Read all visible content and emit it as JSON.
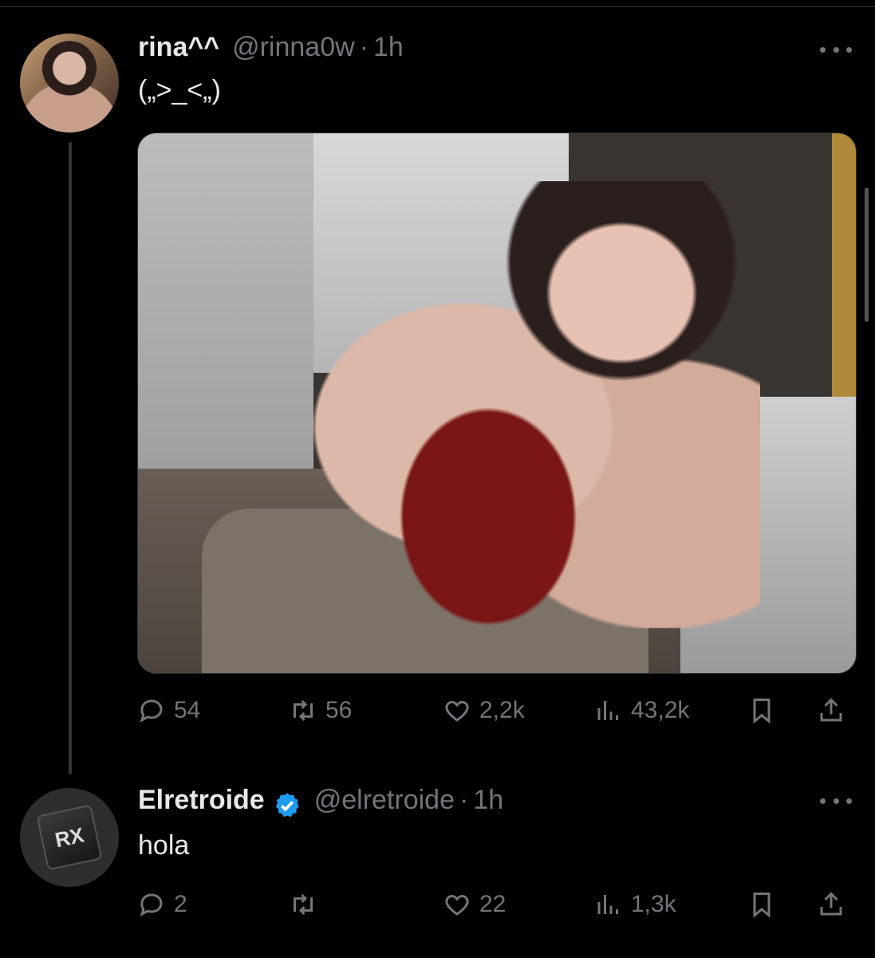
{
  "tweets": [
    {
      "name": "rina^^",
      "handle": "@rinna0w",
      "separator": "·",
      "time": "1h",
      "text": "(„>_<„)",
      "has_media": true,
      "actions": {
        "reply_count": "54",
        "retweet_count": "56",
        "like_count": "2,2k",
        "view_count": "43,2k"
      }
    },
    {
      "name": "Elretroide",
      "handle": "@elretroide",
      "separator": "·",
      "time": "1h",
      "text": "hola",
      "verified": true,
      "actions": {
        "reply_count": "2",
        "retweet_count": "",
        "like_count": "22",
        "view_count": "1,3k"
      }
    }
  ],
  "avatar_logo_text": "RX",
  "colors": {
    "background": "#000000",
    "text_primary": "#e7e9ea",
    "text_secondary": "#71767b",
    "verified_badge": "#1d9bf0",
    "divider": "#2f3336"
  },
  "icons": [
    "more-icon",
    "reply-icon",
    "retweet-icon",
    "like-icon",
    "views-icon",
    "bookmark-icon",
    "share-icon",
    "verified-badge-icon"
  ]
}
